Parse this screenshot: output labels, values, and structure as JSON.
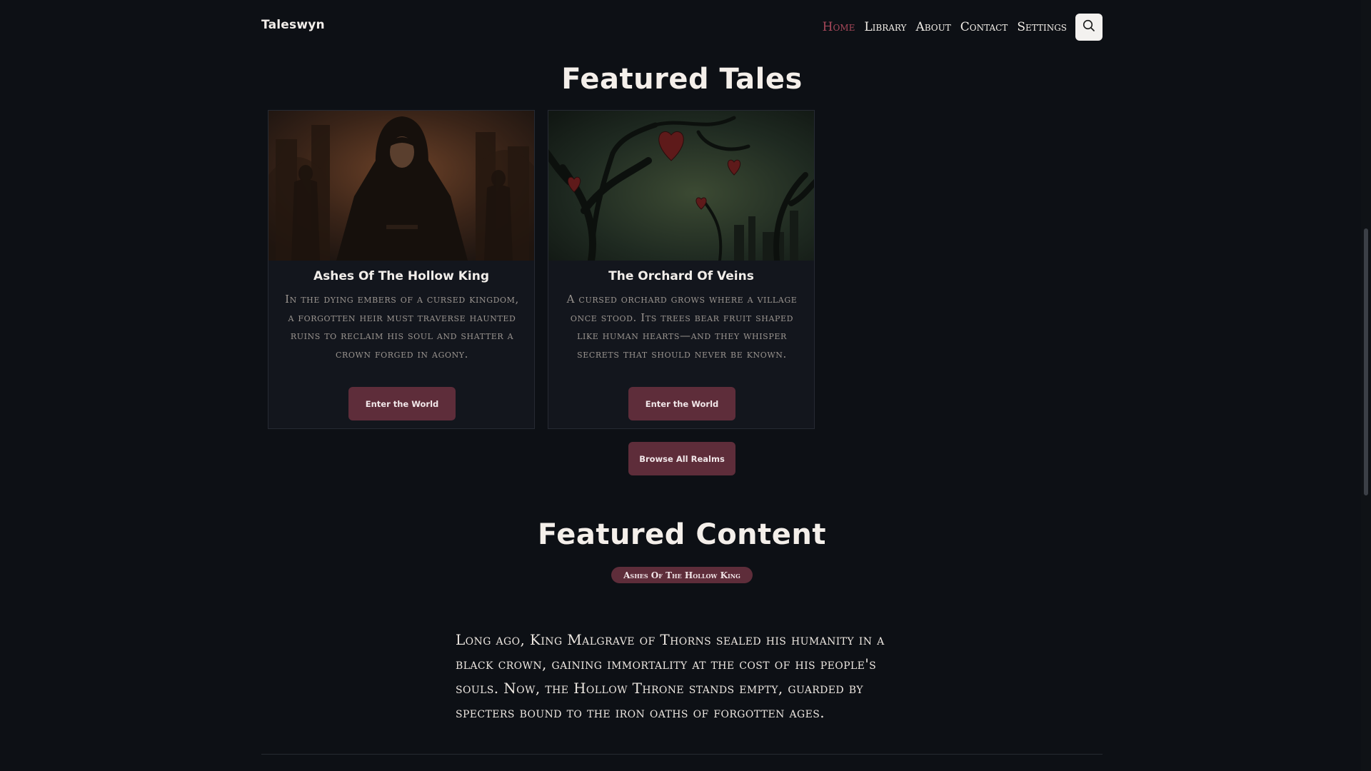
{
  "app": {
    "brand": "Taleswyn"
  },
  "nav": {
    "items": [
      "Home",
      "Library",
      "About",
      "Contact",
      "Settings"
    ],
    "active": "Home"
  },
  "sections": {
    "featured_tales_title": "Featured Tales",
    "featured_content_title": "Featured Content"
  },
  "cards": [
    {
      "title": "Ashes Of The Hollow King",
      "description": "In the dying embers of a cursed kingdom, a forgotten heir must traverse haunted ruins to reclaim his soul and shatter a crown forged in agony.",
      "button": "Enter the World"
    },
    {
      "title": "The Orchard Of Veins",
      "description": "A cursed orchard grows where a village once stood. Its trees bear fruit shaped like human hearts—and they whisper secrets that should never be known.",
      "button": "Enter the World"
    }
  ],
  "browse_button": "Browse All Realms",
  "featured_tag": "Ashes Of The Hollow King",
  "featured_story": "Long ago, King Malgrave of Thorns sealed his humanity in a black crown, gaining immortality at the cost of his people's souls. Now, the Hollow Throne stands empty, guarded by specters bound to the iron oaths of forgotten ages.",
  "colors": {
    "background": "#0d1015",
    "accent": "#5e2d3a",
    "active_nav": "#a8485a"
  },
  "icons": {
    "search": "search-icon"
  }
}
